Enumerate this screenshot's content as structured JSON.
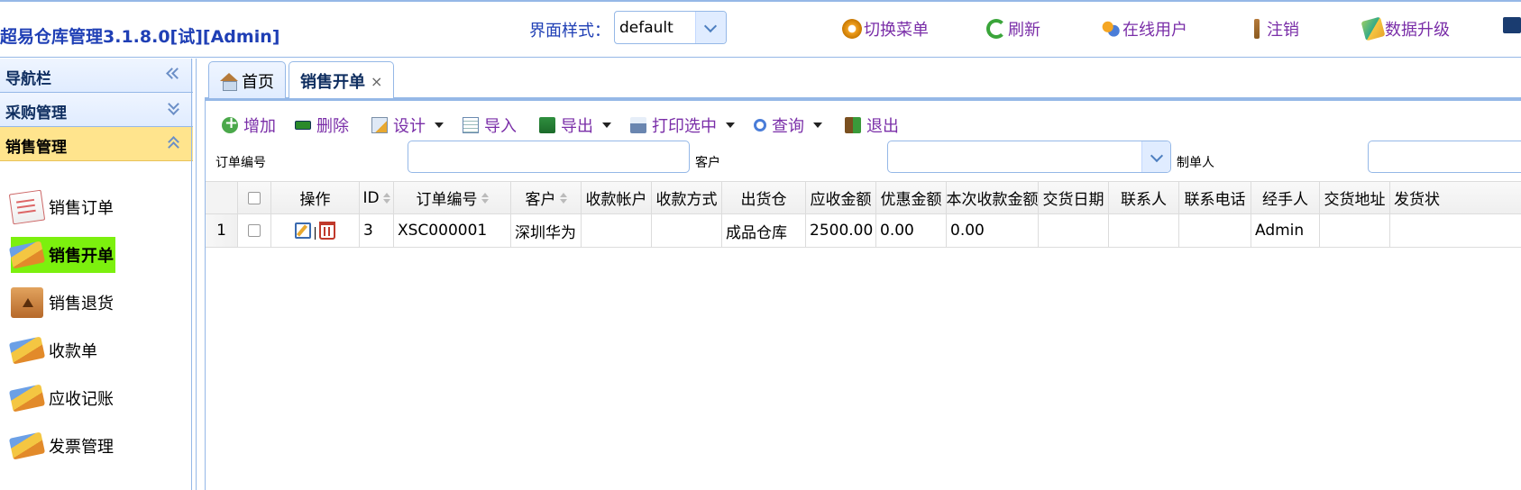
{
  "header": {
    "app_title": "超易仓库管理3.1.8.0[试][Admin]",
    "style_label": "界面样式：",
    "style_value": "default",
    "links": [
      {
        "label": "切换菜单",
        "icon": "gear-icon"
      },
      {
        "label": "刷新",
        "icon": "refresh-icon"
      },
      {
        "label": "在线用户",
        "icon": "users-icon"
      },
      {
        "label": "注销",
        "icon": "logout-icon"
      },
      {
        "label": "数据升级",
        "icon": "upgrade-icon"
      }
    ]
  },
  "sidebar": {
    "nav_title": "导航栏",
    "panels": [
      {
        "label": "采购管理"
      },
      {
        "label": "销售管理"
      }
    ],
    "items": [
      {
        "label": "销售订单",
        "icon": "order-doc-icon"
      },
      {
        "label": "销售开单",
        "icon": "books-icon",
        "selected": true
      },
      {
        "label": "销售退货",
        "icon": "return-box-icon"
      },
      {
        "label": "收款单",
        "icon": "books-icon"
      },
      {
        "label": "应收记账",
        "icon": "books-icon"
      },
      {
        "label": "发票管理",
        "icon": "books-icon"
      }
    ]
  },
  "tabs": [
    {
      "label": "首页",
      "icon": "home-icon"
    },
    {
      "label": "销售开单",
      "closable": true,
      "active": true,
      "close": "×"
    }
  ],
  "toolbar": {
    "add": "增加",
    "delete": "删除",
    "design": "设计",
    "import": "导入",
    "export": "导出",
    "print": "打印选中",
    "query": "查询",
    "exit": "退出"
  },
  "filters": {
    "order_no_label": "订单编号",
    "customer_label": "客户",
    "maker_label": "制单人",
    "order_no_value": "",
    "customer_value": "",
    "maker_value": ""
  },
  "grid": {
    "columns": [
      "操作",
      "ID",
      "订单编号",
      "客户",
      "收款帐户",
      "收款方式",
      "出货仓",
      "应收金额",
      "优惠金额",
      "本次收款金额",
      "交货日期",
      "联系人",
      "联系电话",
      "经手人",
      "交货地址",
      "发货状"
    ],
    "rows": [
      {
        "num": "1",
        "id": "3",
        "order_no": "XSC000001",
        "customer": "深圳华为",
        "account": "",
        "pay_method": "",
        "warehouse": "成品仓库",
        "receivable": "2500.00",
        "discount": "0.00",
        "received": "0.00",
        "delivery_date": "",
        "contact": "",
        "phone": "",
        "handler": "Admin",
        "address": "",
        "ship_status": ""
      }
    ]
  }
}
